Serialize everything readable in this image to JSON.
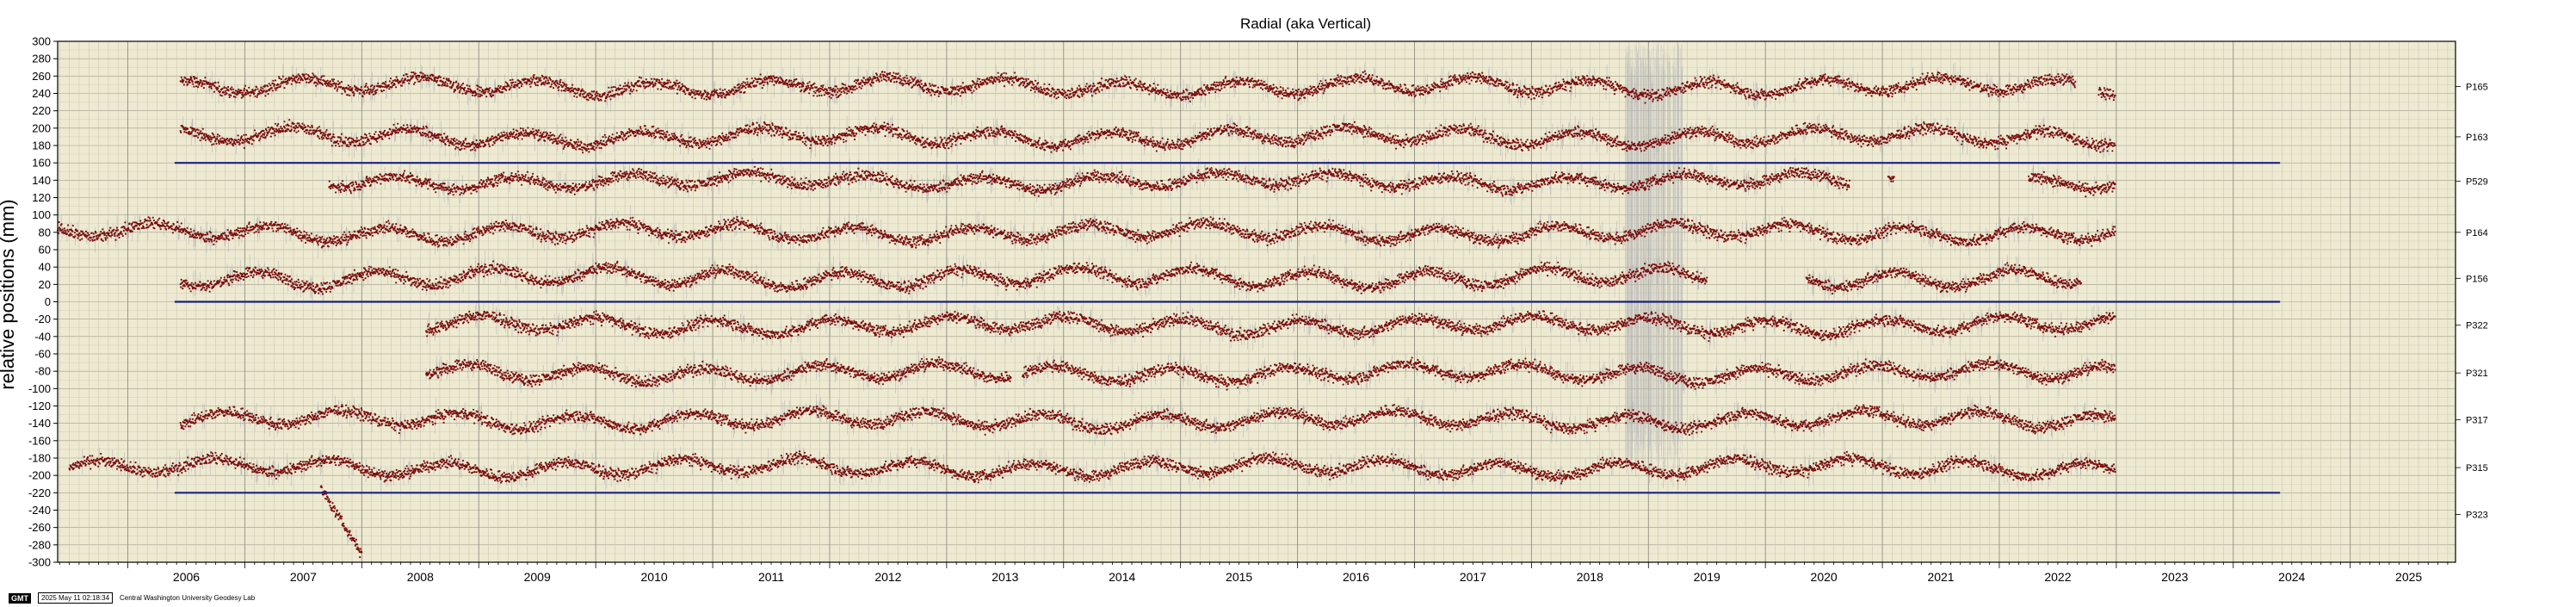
{
  "chart_data": {
    "type": "scatter",
    "title": "Radial (aka Vertical)",
    "ylabel": "relative positions (mm)",
    "xlabel": "",
    "xlim": [
      2005.4,
      2025.9
    ],
    "ylim": [
      -300,
      300
    ],
    "grid": true,
    "background_color": "#eeead2",
    "point_color": "#7a0d0d",
    "error_color": "#b8b8b8",
    "reference_line_color": "#1a237e",
    "y_ticks": [
      300,
      280,
      260,
      240,
      220,
      200,
      180,
      160,
      140,
      120,
      100,
      80,
      60,
      40,
      20,
      0,
      -20,
      -40,
      -60,
      -80,
      -100,
      -120,
      -140,
      -160,
      -180,
      -200,
      -220,
      -240,
      -260,
      -280,
      -300
    ],
    "x_ticks": [
      "2006",
      "2007",
      "2008",
      "2009",
      "2010",
      "2011",
      "2012",
      "2013",
      "2014",
      "2015",
      "2016",
      "2017",
      "2018",
      "2019",
      "2020",
      "2021",
      "2022",
      "2023",
      "2024",
      "2025"
    ],
    "reference_lines": [
      {
        "y": 160,
        "x_start": 2006.4,
        "x_end": 2024.4
      },
      {
        "y": 0,
        "x_start": 2006.4,
        "x_end": 2024.4
      },
      {
        "y": -220,
        "x_start": 2006.4,
        "x_end": 2024.4
      }
    ],
    "series": [
      {
        "name": "P165",
        "label_y": 248,
        "offset": 248,
        "amplitude": 8,
        "segments": [
          [
            2006.45,
            2022.65
          ],
          [
            2022.85,
            2022.99
          ]
        ]
      },
      {
        "name": "P163",
        "label_y": 190,
        "offset": 190,
        "amplitude": 8,
        "segments": [
          [
            2006.45,
            2022.99
          ]
        ]
      },
      {
        "name": "P529",
        "label_y": 139,
        "offset": 139,
        "amplitude": 7,
        "segments": [
          [
            2007.72,
            2020.72
          ],
          [
            2021.05,
            2021.1
          ],
          [
            2022.25,
            2022.99
          ]
        ]
      },
      {
        "name": "P164",
        "label_y": 80,
        "offset": 80,
        "amplitude": 8,
        "segments": [
          [
            2005.4,
            2022.99
          ]
        ]
      },
      {
        "name": "P156",
        "label_y": 27,
        "offset": 28,
        "amplitude": 9,
        "segments": [
          [
            2006.45,
            2019.5
          ],
          [
            2020.35,
            2022.7
          ]
        ]
      },
      {
        "name": "P322",
        "label_y": -27,
        "offset": -27,
        "amplitude": 8,
        "segments": [
          [
            2008.55,
            2022.99
          ]
        ]
      },
      {
        "name": "P321",
        "label_y": -82,
        "offset": -82,
        "amplitude": 8,
        "segments": [
          [
            2008.55,
            2013.55
          ],
          [
            2013.65,
            2022.99
          ]
        ]
      },
      {
        "name": "P317",
        "label_y": -136,
        "offset": -136,
        "amplitude": 8,
        "segments": [
          [
            2006.45,
            2022.99
          ]
        ]
      },
      {
        "name": "P315",
        "label_y": -191,
        "offset": -191,
        "amplitude": 8,
        "segments": [
          [
            2005.5,
            2022.99
          ]
        ]
      },
      {
        "name": "P323",
        "label_y": -245,
        "offset": -245,
        "amplitude": 0,
        "segments": [
          [
            2007.65,
            2008.0
          ]
        ]
      }
    ]
  },
  "footer": {
    "badge": "GMT",
    "timestamp": "2025 May 11 02:18:34",
    "credit": "Central Washington University Geodesy Lab"
  }
}
